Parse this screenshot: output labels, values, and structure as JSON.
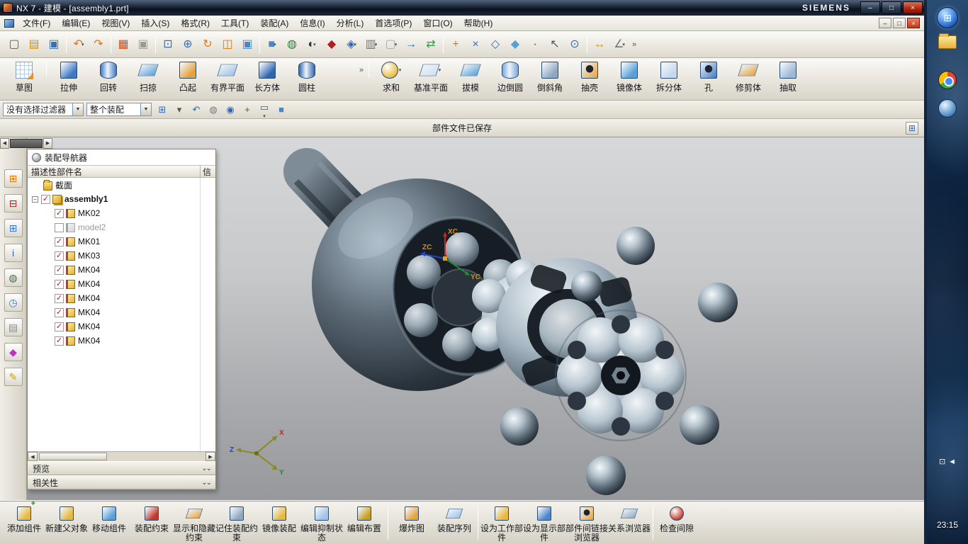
{
  "glyphs": {
    "left": "◀",
    "right": "▶",
    "down": "⌄",
    "dd": "▾",
    "overflow": "»",
    "check": "✓",
    "minus": "−"
  },
  "titlebar": {
    "title": "NX 7 - 建模 - [assembly1.prt]",
    "brand": "SIEMENS",
    "controls": [
      {
        "name": "window-minimize-button",
        "glyph": "–",
        "kind": "min"
      },
      {
        "name": "window-maximize-button",
        "glyph": "□",
        "kind": "max"
      },
      {
        "name": "window-close-button",
        "glyph": "×",
        "kind": "close"
      }
    ]
  },
  "menubar": {
    "items": [
      {
        "name": "menu-file",
        "label": "文件(F)"
      },
      {
        "name": "menu-edit",
        "label": "编辑(E)"
      },
      {
        "name": "menu-view",
        "label": "视图(V)"
      },
      {
        "name": "menu-insert",
        "label": "插入(S)"
      },
      {
        "name": "menu-format",
        "label": "格式(R)"
      },
      {
        "name": "menu-tools",
        "label": "工具(T)"
      },
      {
        "name": "menu-assemblies",
        "label": "装配(A)"
      },
      {
        "name": "menu-information",
        "label": "信息(I)"
      },
      {
        "name": "menu-analysis",
        "label": "分析(L)"
      },
      {
        "name": "menu-preferences",
        "label": "首选项(P)"
      },
      {
        "name": "menu-window",
        "label": "窗口(O)"
      },
      {
        "name": "menu-help",
        "label": "帮助(H)"
      }
    ],
    "controls": [
      {
        "name": "mdi-minimize-button",
        "glyph": "–",
        "kind": "min"
      },
      {
        "name": "mdi-restore-button",
        "glyph": "□",
        "kind": "max"
      },
      {
        "name": "mdi-close-button",
        "glyph": "×",
        "kind": "close"
      }
    ]
  },
  "toolbar_main": [
    {
      "name": "new-button",
      "icon": "new-file-icon",
      "glyph": "▢",
      "color": "#5a5a5a"
    },
    {
      "name": "open-button",
      "icon": "open-folder-icon",
      "glyph": "▤",
      "color": "#c8921e"
    },
    {
      "name": "save-button",
      "icon": "save-icon",
      "glyph": "▣",
      "color": "#3a6fb5"
    },
    {
      "sep": true
    },
    {
      "name": "undo-button",
      "icon": "undo-icon",
      "glyph": "↶",
      "color": "#e07818",
      "dropdown": true
    },
    {
      "name": "redo-button",
      "icon": "redo-icon",
      "glyph": "↷",
      "color": "#e07818"
    },
    {
      "sep": true
    },
    {
      "name": "delete-button",
      "icon": "delete-icon",
      "glyph": "▦",
      "color": "#d05020"
    },
    {
      "name": "paste-button",
      "icon": "paste-icon",
      "glyph": "▣",
      "color": "#9a9a92"
    },
    {
      "sep": true
    },
    {
      "name": "fit-view-button",
      "icon": "fit-view-icon",
      "glyph": "⊡",
      "color": "#3a6fb5"
    },
    {
      "name": "zoom-button",
      "icon": "zoom-icon",
      "glyph": "⊕",
      "color": "#3a6fb5"
    },
    {
      "name": "rotate-view-button",
      "icon": "rotate-view-icon",
      "glyph": "↻",
      "color": "#e07818"
    },
    {
      "name": "layout-window-button",
      "icon": "window-icon",
      "glyph": "◫",
      "color": "#e07818"
    },
    {
      "name": "snapshot-button",
      "icon": "window-shaded-icon",
      "glyph": "▣",
      "color": "#4a86c8"
    },
    {
      "sep": true
    },
    {
      "name": "shaded-display-button",
      "icon": "shaded-cube-icon",
      "glyph": "■",
      "color": "#4a86c8",
      "dropdown": true
    },
    {
      "name": "world-view-button",
      "icon": "globe-icon",
      "glyph": "◍",
      "color": "#2f7a3e"
    },
    {
      "name": "rendering-style-button",
      "icon": "half-sphere-icon",
      "glyph": "◐",
      "color": "#333333",
      "dropdown": true
    },
    {
      "name": "datum-display-button",
      "icon": "datum-icon",
      "glyph": "◆",
      "color": "#b02020"
    },
    {
      "name": "csys-display-button",
      "icon": "csys-icon",
      "glyph": "◈",
      "color": "#2f66b0",
      "dropdown": true
    },
    {
      "name": "view-section-button",
      "icon": "view-section-icon",
      "glyph": "▥",
      "color": "#777777",
      "dropdown": true
    },
    {
      "name": "background-color-button",
      "icon": "background-icon",
      "glyph": "▢",
      "color": "#aaaaaa",
      "dropdown": true
    },
    {
      "name": "orient-view-button",
      "icon": "orient-arrow-icon",
      "glyph": "→",
      "color": "#2f66b0"
    },
    {
      "name": "swap-view-button",
      "icon": "swap-arrows-icon",
      "glyph": "⇄",
      "color": "#2f9e44"
    },
    {
      "sep": true
    },
    {
      "name": "snap-point-button",
      "icon": "snap-point-icon",
      "glyph": "+",
      "color": "#e07818"
    },
    {
      "name": "snap-endpoint-button",
      "icon": "snap-endpoint-icon",
      "glyph": "×",
      "color": "#3a6fb5"
    },
    {
      "name": "snap-midpoint-button",
      "icon": "snap-midpoint-icon",
      "glyph": "◇",
      "color": "#3a6fb5"
    },
    {
      "name": "snap-quadrant-button",
      "icon": "snap-quadrant-icon",
      "glyph": "◆",
      "color": "#58a0d8"
    },
    {
      "name": "snap-center-button",
      "icon": "snap-center-icon",
      "glyph": "·",
      "color": "#444444"
    },
    {
      "name": "selection-cursor-button",
      "icon": "cursor-icon",
      "glyph": "↖",
      "color": "#555555"
    },
    {
      "name": "snap-intersection-button",
      "icon": "snap-intersection-icon",
      "glyph": "⊙",
      "color": "#3a6fb5"
    },
    {
      "sep": true
    },
    {
      "name": "measure-distance-button",
      "icon": "measure-distance-icon",
      "glyph": "↔",
      "color": "#c8921e"
    },
    {
      "name": "measure-angle-button",
      "icon": "measure-angle-icon",
      "glyph": "∠",
      "color": "#777777",
      "dropdown": true
    },
    {
      "overflow": true,
      "name": "standard-toolbar-overflow"
    }
  ],
  "feature_toolbar": [
    {
      "name": "sketch-button",
      "label": "草图",
      "shape": "sketch",
      "color": "#dce8f4"
    },
    {
      "sep": true
    },
    {
      "name": "extrude-button",
      "label": "拉伸",
      "shape": "cube",
      "color": "#3f79c2"
    },
    {
      "name": "revolve-button",
      "label": "回转",
      "shape": "cyl",
      "color": "#3f79c2"
    },
    {
      "name": "sweep-button",
      "label": "扫掠",
      "shape": "plane",
      "color": "#58a0d8"
    },
    {
      "name": "boss-button",
      "label": "凸起",
      "shape": "cube",
      "color": "#e8a23c"
    },
    {
      "name": "bounded-plane-button",
      "label": "有界平面",
      "shape": "plane",
      "color": "#9fc2e8"
    },
    {
      "name": "block-button",
      "label": "长方体",
      "shape": "cube",
      "color": "#2f66b0"
    },
    {
      "name": "cylinder-button",
      "label": "圆柱",
      "shape": "cyl",
      "color": "#2f66b0"
    },
    {
      "spacer": true
    },
    {
      "overflow": true,
      "name": "modeling-toolbar-overflow"
    },
    {
      "sep": true
    },
    {
      "name": "unite-button",
      "label": "求和",
      "shape": "sphere",
      "color": "#e8b93c",
      "dropdown": true
    },
    {
      "name": "datum-plane-button",
      "label": "基准平面",
      "shape": "plane",
      "color": "#cfe0f0",
      "dropdown": true
    },
    {
      "name": "draft-button",
      "label": "拔模",
      "shape": "plane",
      "color": "#58a0d8"
    },
    {
      "name": "edge-blend-button",
      "label": "边倒圆",
      "shape": "cyl",
      "color": "#7aa8d8"
    },
    {
      "name": "chamfer-button",
      "label": "倒斜角",
      "shape": "cube",
      "color": "#8fa8c0"
    },
    {
      "name": "shell-button",
      "label": "抽壳",
      "shape": "hole",
      "color": "#e8a23c"
    },
    {
      "name": "mirror-body-button",
      "label": "镜像体",
      "shape": "cube",
      "color": "#58a0d8"
    },
    {
      "name": "split-body-button",
      "label": "拆分体",
      "shape": "cube",
      "color": "#c8d8ea"
    },
    {
      "name": "hole-button",
      "label": "孔",
      "shape": "hole",
      "color": "#3f79c2"
    },
    {
      "name": "trim-body-button",
      "label": "修剪体",
      "shape": "plane",
      "color": "#e8a23c"
    },
    {
      "name": "extract-button",
      "label": "抽取",
      "shape": "cube",
      "color": "#9fb8d8"
    }
  ],
  "selection_bar": {
    "filter": {
      "name": "selection-filter-dropdown",
      "value": "没有选择过滤器"
    },
    "scope": {
      "name": "selection-scope-dropdown",
      "value": "整个装配"
    },
    "icons": [
      {
        "name": "snap-point-toggle-button",
        "glyph": "⊞",
        "color": "#3a6fb5"
      },
      {
        "name": "selection-combo-button",
        "glyph": "▾",
        "color": "#555555"
      },
      {
        "name": "previous-selection-button",
        "glyph": "↶",
        "color": "#2f66b0"
      },
      {
        "name": "highlight-sphere-button",
        "glyph": "◍",
        "color": "#777777"
      },
      {
        "name": "orbit-selection-button",
        "glyph": "◉",
        "color": "#2f66b0"
      },
      {
        "name": "general-selection-button",
        "glyph": "+",
        "color": "#555555"
      },
      {
        "name": "rectangle-select-button",
        "glyph": "▭",
        "color": "#555555",
        "dropdown": true
      },
      {
        "name": "shaded-cube-button",
        "glyph": "■",
        "color": "#4a86c8"
      }
    ]
  },
  "status_bar": {
    "message": "部件文件已保存"
  },
  "resource_bar": [
    {
      "name": "assembly-navigator-tab-icon",
      "glyph": "⊞",
      "color": "#e07818"
    },
    {
      "name": "constraint-navigator-tab-icon",
      "glyph": "⊟",
      "color": "#b02020"
    },
    {
      "name": "part-navigator-tab-icon",
      "glyph": "⊞",
      "color": "#3f79c2"
    },
    {
      "name": "reuse-library-tab-icon",
      "glyph": "i",
      "color": "#2f66b0"
    },
    {
      "name": "web-browser-tab-icon",
      "glyph": "◍",
      "color": "#2f7a3e"
    },
    {
      "name": "history-tab-icon",
      "glyph": "◷",
      "color": "#3f79c2"
    },
    {
      "name": "system-materials-tab-icon",
      "glyph": "▤",
      "color": "#888888"
    },
    {
      "name": "visualization-tab-icon",
      "glyph": "◆",
      "color": "#c030c0"
    },
    {
      "name": "roles-tab-icon",
      "glyph": "✎",
      "color": "#c8a020"
    }
  ],
  "navigator": {
    "title": "装配导航器",
    "columns": {
      "name": "描述性部件名",
      "info": "信"
    },
    "rows": [
      {
        "name": "tree-row-sections",
        "label": "截面",
        "icon": "folder",
        "indent": 1
      },
      {
        "name": "tree-row-assembly1",
        "label": "assembly1",
        "icon": "assembly",
        "indent": 0,
        "expander": true,
        "checkbox": true,
        "bold": true
      },
      {
        "name": "tree-row-mk02",
        "label": "MK02",
        "icon": "part",
        "indent": 2,
        "checkbox": true
      },
      {
        "name": "tree-row-model2",
        "label": "model2",
        "icon": "part",
        "indent": 2,
        "checkbox": false,
        "gray": true
      },
      {
        "name": "tree-row-mk01",
        "label": "MK01",
        "icon": "part",
        "indent": 2,
        "checkbox": true
      },
      {
        "name": "tree-row-mk03",
        "label": "MK03",
        "icon": "part",
        "indent": 2,
        "checkbox": true
      },
      {
        "name": "tree-row-mk04-1",
        "label": "MK04",
        "icon": "part",
        "indent": 2,
        "checkbox": true
      },
      {
        "name": "tree-row-mk04-2",
        "label": "MK04",
        "icon": "part",
        "indent": 2,
        "checkbox": true
      },
      {
        "name": "tree-row-mk04-3",
        "label": "MK04",
        "icon": "part",
        "indent": 2,
        "checkbox": true
      },
      {
        "name": "tree-row-mk04-4",
        "label": "MK04",
        "icon": "part",
        "indent": 2,
        "checkbox": true
      },
      {
        "name": "tree-row-mk04-5",
        "label": "MK04",
        "icon": "part",
        "indent": 2,
        "checkbox": true
      },
      {
        "name": "tree-row-mk04-6",
        "label": "MK04",
        "icon": "part",
        "indent": 2,
        "checkbox": true
      }
    ],
    "sections": [
      {
        "name": "preview-section",
        "label": "预览"
      },
      {
        "name": "dependencies-section",
        "label": "相关性"
      }
    ]
  },
  "assembly_toolbar": [
    {
      "name": "add-component-button",
      "label": "添加组件",
      "shape": "cube",
      "color": "#e8b93c",
      "badge": "+"
    },
    {
      "name": "new-parent-button",
      "label": "新建父对象",
      "shape": "cube",
      "color": "#e8b93c"
    },
    {
      "name": "move-component-button",
      "label": "移动组件",
      "shape": "cube",
      "color": "#58a0d8"
    },
    {
      "name": "assembly-constraints-button",
      "label": "装配约束",
      "shape": "cube",
      "color": "#c23a2a"
    },
    {
      "name": "show-hide-constraints-button",
      "label": "显示和隐藏约束",
      "shape": "plane",
      "color": "#e8a23c"
    },
    {
      "name": "remember-constraints-button",
      "label": "记住装配约束",
      "shape": "cube",
      "color": "#8fa8c0"
    },
    {
      "name": "mirror-assembly-button",
      "label": "镜像装配",
      "shape": "cube",
      "color": "#e8b93c"
    },
    {
      "name": "edit-suppression-button",
      "label": "编辑抑制状态",
      "shape": "cube",
      "color": "#9fc2e8"
    },
    {
      "name": "edit-arrangements-button",
      "label": "编辑布置",
      "shape": "cube",
      "color": "#c8a020"
    },
    {
      "sep": true
    },
    {
      "name": "exploded-views-button",
      "label": "爆炸图",
      "shape": "cube",
      "color": "#e8a23c"
    },
    {
      "name": "assembly-sequence-button",
      "label": "装配序列",
      "shape": "plane",
      "color": "#9fc2e8"
    },
    {
      "sep": true
    },
    {
      "name": "make-work-part-button",
      "label": "设为工作部件",
      "shape": "cube",
      "color": "#e8b93c"
    },
    {
      "name": "make-displayed-part-button",
      "label": "设为显示部件",
      "shape": "cube",
      "color": "#4a86c8"
    },
    {
      "name": "interpart-link-browser-button",
      "label": "部件间链接浏览器",
      "shape": "hole",
      "color": "#e8a23c"
    },
    {
      "name": "relations-browser-button",
      "label": "关系浏览器",
      "shape": "plane",
      "color": "#8fa8c0"
    },
    {
      "sep": true
    },
    {
      "name": "check-clearance-button",
      "label": "检查间隙",
      "shape": "sphere",
      "color": "#c23a2a"
    }
  ],
  "viewport": {
    "wcs": {
      "xc": "XC",
      "yc": "YC",
      "zc": "ZC"
    },
    "triad": {
      "x": "X",
      "y": "Y",
      "z": "Z"
    }
  },
  "taskbar": {
    "clock": "23:15",
    "tray": [
      {
        "name": "tray-display-icon",
        "glyph": "⊡"
      },
      {
        "name": "tray-volume-icon",
        "glyph": "◄"
      }
    ]
  }
}
